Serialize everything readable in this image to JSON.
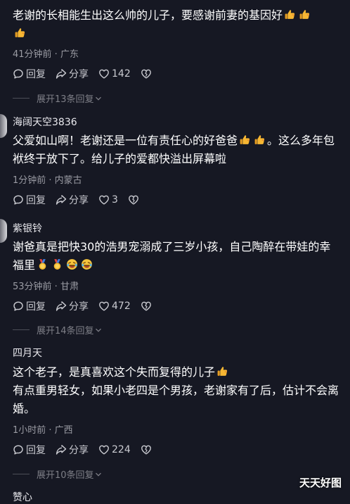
{
  "comments": [
    {
      "username": "",
      "lines": [
        "老谢的长相能生出这么帅的儿子，要感谢前妻的基因好"
      ],
      "meta": "41分钟前 · 广东",
      "reply_label": "回复",
      "share_label": "分享",
      "likes": "142",
      "expand": "展开13条回复"
    },
    {
      "username": "海阔天空3836",
      "lines": [
        "父爱如山啊！老谢还是一位有责任心的好爸爸",
        "。这么多年包袱终于放下了。给儿子的爱都快溢出屏幕啦"
      ],
      "meta": "1分钟前 · 内蒙古",
      "reply_label": "回复",
      "share_label": "分享",
      "likes": "3"
    },
    {
      "username": "紫银铃",
      "lines": [
        "谢爸真是把快30的浩男宠溺成了三岁小孩，自己陶醉在带娃的幸福里"
      ],
      "meta": "53分钟前 · 甘肃",
      "reply_label": "回复",
      "share_label": "分享",
      "likes": "472",
      "expand": "展开14条回复"
    },
    {
      "username": "四月天",
      "lines": [
        "这个老子，是真喜欢这个失而复得的儿子",
        "有点重男轻女，如果小老四是个男孩，老谢家有了后，估计不会离婚。"
      ],
      "meta": "1小时前 · 广西",
      "reply_label": "回复",
      "share_label": "分享",
      "likes": "224",
      "expand": "展开10条回复"
    }
  ],
  "next_username_partial": "赞心",
  "watermark": "天天好图",
  "icons": {
    "reply": "comment-bubble-icon",
    "share": "share-arrow-icon",
    "like": "heart-icon",
    "dislike": "broken-heart-icon",
    "expand": "chevron-down-icon",
    "emoji_thumb": "thumbs-up-emoji",
    "emoji_medal": "medal-emoji",
    "emoji_laugh": "rolling-laugh-emoji"
  },
  "colors": {
    "background": "#161823",
    "text": "#ffffff",
    "meta": "#9a9ba3",
    "emoji": "#f5a623"
  }
}
